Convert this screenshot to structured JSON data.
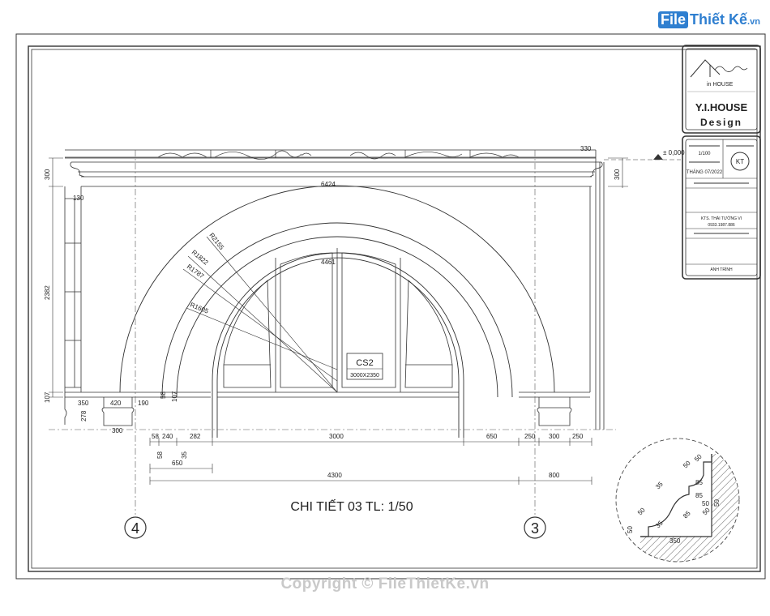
{
  "site_logo": {
    "tag": "File",
    "name": "Thiết Kế",
    "suffix": ".vn"
  },
  "watermark": "Copyright © FileThietKe.vn",
  "title": "CHI TIẾT 03 TL: 1/50",
  "axes": {
    "left": "4",
    "right": "3"
  },
  "level": "± 0,000",
  "window": {
    "code": "CS2",
    "size": "3000X2350"
  },
  "radii": {
    "r1": "R2155",
    "r2": "R1822",
    "r3": "R1787",
    "r4": "R1605"
  },
  "arch_dims": {
    "outer": "6424",
    "inner": "4461"
  },
  "dims_vertical": {
    "cornice": "300",
    "height": "2382",
    "base": "107",
    "cornice_right": "300",
    "small1": "58",
    "small2": "107",
    "cap": "278"
  },
  "dims_top": {
    "right": "330",
    "left_offset": "130"
  },
  "dims_base": {
    "d420": "420",
    "d190": "190",
    "d350": "350",
    "d300": "300"
  },
  "dims_row1": [
    "58",
    "240",
    "282",
    "3000",
    "650",
    "250",
    "300",
    "250"
  ],
  "dims_row2": {
    "a": "650",
    "b": "58",
    "c": "35"
  },
  "dims_row3": {
    "a": "4300",
    "b": "800"
  },
  "profile_dims": [
    "50",
    "50",
    "35",
    "50",
    "85",
    "85",
    "85",
    "350",
    "50",
    "50",
    "35",
    "50",
    "50"
  ],
  "title_block": {
    "brand_name": "Y.I.HOUSE",
    "brand_sub": "Design",
    "logo_text": "in HOUSE",
    "scale": "1/100",
    "date": "THÁNG 07/2022",
    "stamp": "KT",
    "owner": "KTS. THÁI TƯỜNG VI",
    "phone": "0933.1987.886",
    "signer": "ANH TRÌNH"
  }
}
